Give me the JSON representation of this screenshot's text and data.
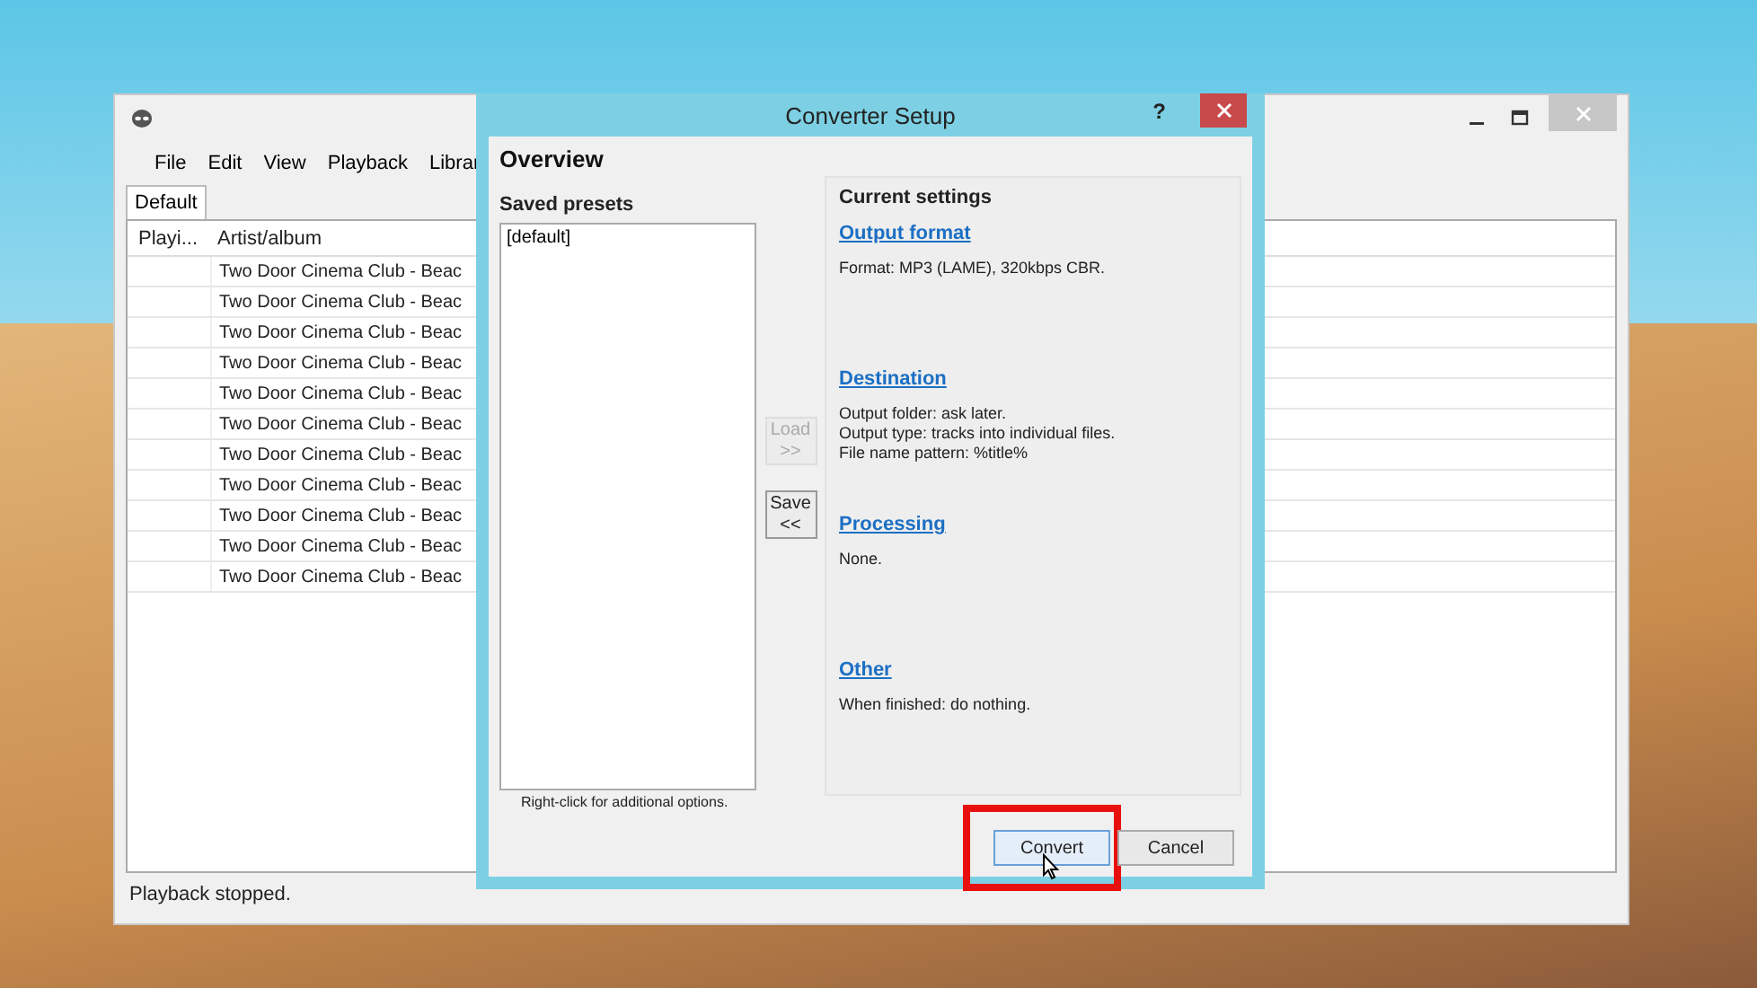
{
  "main_window": {
    "menu": [
      "File",
      "Edit",
      "View",
      "Playback",
      "Librar"
    ],
    "tabs": [
      {
        "label": "Default",
        "selected": true
      }
    ],
    "columns": [
      "Playi...",
      "Artist/album"
    ],
    "rows": [
      "Two Door Cinema Club - Beac",
      "Two Door Cinema Club - Beac",
      "Two Door Cinema Club - Beac",
      "Two Door Cinema Club - Beac",
      "Two Door Cinema Club - Beac",
      "Two Door Cinema Club - Beac",
      "Two Door Cinema Club - Beac",
      "Two Door Cinema Club - Beac",
      "Two Door Cinema Club - Beac",
      "Two Door Cinema Club - Beac",
      "Two Door Cinema Club - Beac"
    ],
    "status_bar": "Playback stopped."
  },
  "dialog": {
    "title": "Converter Setup",
    "help": "?",
    "section": "Overview",
    "presets_label": "Saved presets",
    "presets": [
      {
        "label": "[default]",
        "selected": false
      }
    ],
    "presets_hint": "Right-click for additional options.",
    "side_buttons": [
      {
        "label": "Load",
        "arrow": ">>",
        "disabled": true
      },
      {
        "label": "Save",
        "arrow": "<<",
        "disabled": false
      }
    ],
    "settings_title": "Current settings",
    "settings": [
      {
        "heading": "Output format",
        "lines": [
          "Format: MP3 (LAME), 320kbps CBR."
        ]
      },
      {
        "heading": "Destination",
        "lines": [
          "Output folder: ask later.",
          "Output type: tracks into individual files.",
          "File name pattern: %title%"
        ]
      },
      {
        "heading": "Processing",
        "lines": [
          "None."
        ]
      },
      {
        "heading": "Other",
        "lines": [
          "When finished: do nothing."
        ]
      }
    ],
    "buttons": [
      {
        "label": "Convert",
        "highlighted": true
      },
      {
        "label": "Cancel",
        "highlighted": false
      }
    ]
  }
}
